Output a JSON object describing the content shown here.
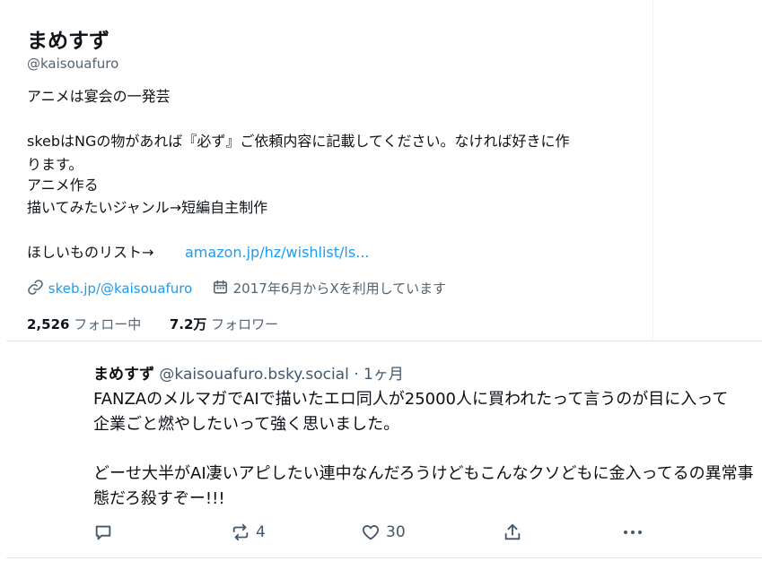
{
  "profile": {
    "display_name": "まめすず",
    "handle": "@kaisouafuro",
    "bio_lines": [
      "アニメは宴会の一発芸",
      "skebはNGの物があれば『必ず』ご依頼内容に記載してください。なければ好きに作",
      "ります。",
      "アニメ作る",
      "描いてみたいジャンル→短編自主制作",
      "ほしいものリスト→"
    ],
    "wishlist_link": "amazon.jp/hz/wishlist/ls...",
    "skeb_link": "skeb.jp/@kaisouafuro",
    "joined": "2017年6月からXを利用しています",
    "following_count": "2,526",
    "following_label": "フォロー中",
    "followers_count": "7.2万",
    "followers_label": "フォロワー"
  },
  "post": {
    "author": "まめすず",
    "handle": "@kaisouafuro.bsky.social",
    "time": "· 1ヶ月",
    "lines": [
      "FANZAのメルマガでAIで描いたエロ同人が25000人に買われたって言うのが目に入って",
      "企業ごと燃やしたいって強く思いました。",
      "どーせ大半がAI凄いアピしたい連中なんだろうけどもこんなクソどもに金入ってるの異常事",
      "態だろ殺すぞー!!!"
    ],
    "repost_count": "4",
    "like_count": "30"
  },
  "icons": [
    "link-icon",
    "calendar-icon",
    "reply-icon",
    "repost-icon",
    "like-icon",
    "share-icon",
    "more-icon"
  ],
  "colors": {
    "link": "#1d9bf0",
    "secondary": "#536471",
    "bsky_secondary": "#42576c"
  }
}
